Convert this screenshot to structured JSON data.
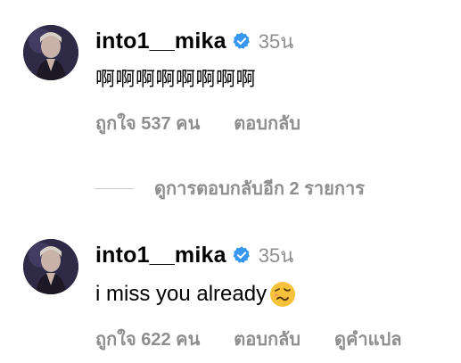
{
  "comments": [
    {
      "username": "into1__mika",
      "timestamp": "35น",
      "text": "啊啊啊啊啊啊啊啊",
      "likes_label": "ถูกใจ 537 คน",
      "reply_label": "ตอบกลับ"
    },
    {
      "username": "into1__mika",
      "timestamp": "35น",
      "text": "i miss you already",
      "emoji": "woozy-face",
      "likes_label": "ถูกใจ 622 คน",
      "reply_label": "ตอบกลับ",
      "translate_label": "ดูคำแปล"
    }
  ],
  "view_replies": "ดูการตอบกลับอีก 2 รายการ",
  "colors": {
    "verified": "#3897f0",
    "secondary_text": "#8e8e8e",
    "divider": "#c7c7c7"
  }
}
